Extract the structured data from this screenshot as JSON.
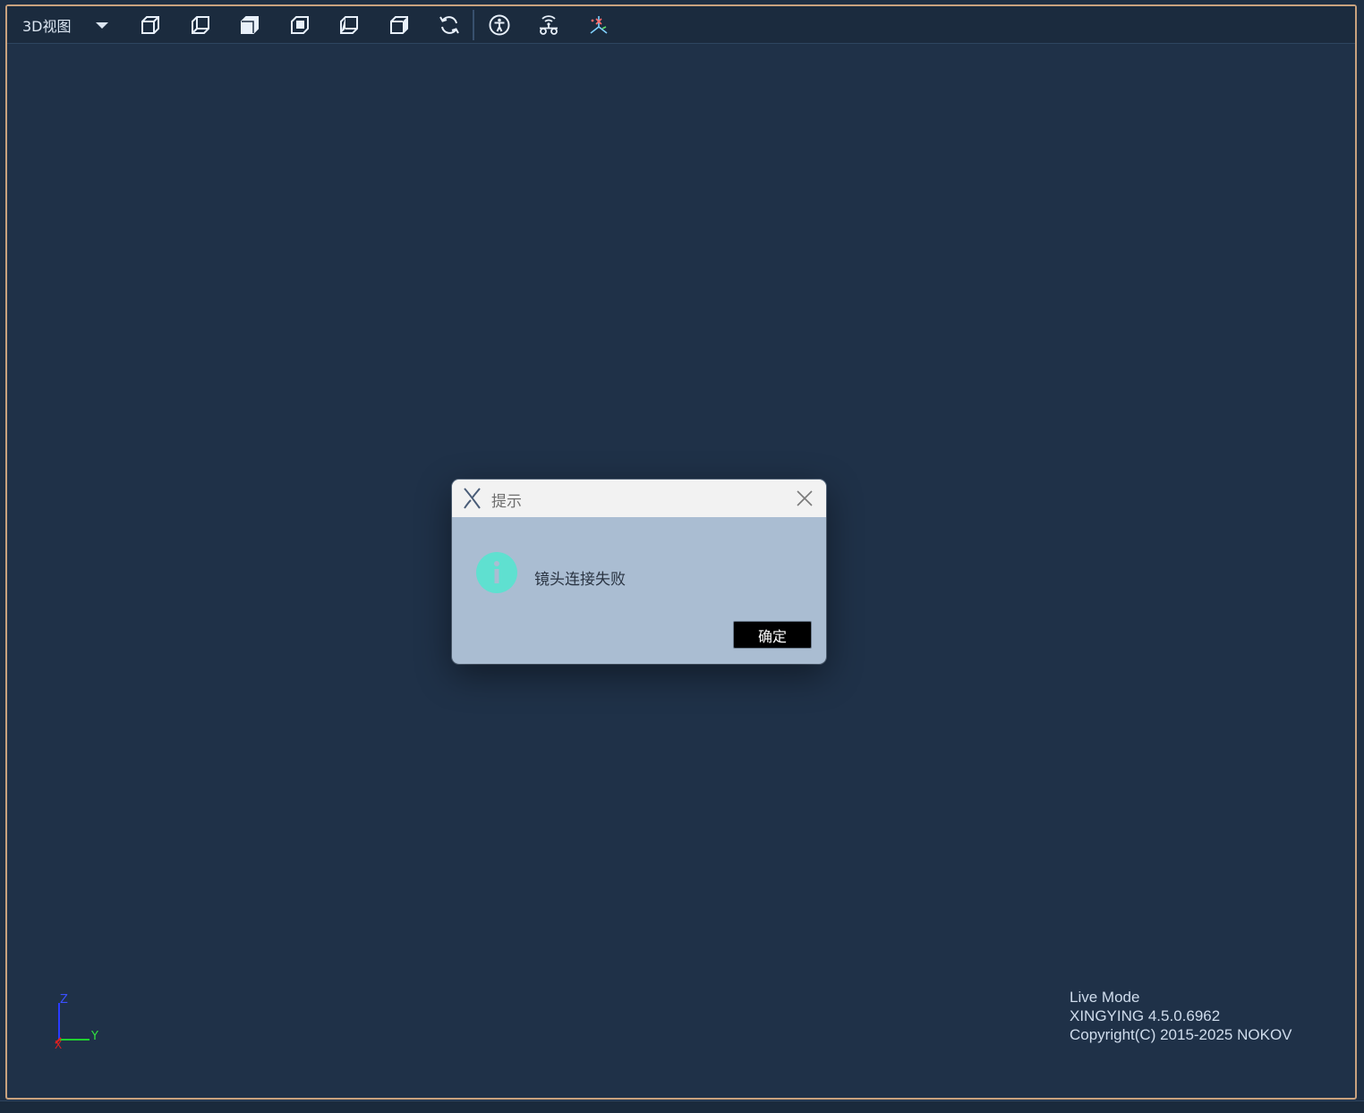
{
  "toolbar": {
    "view_mode": "3D视图",
    "buttons": [
      {
        "icon": "cube-front-icon"
      },
      {
        "icon": "cube-back-icon"
      },
      {
        "icon": "cube-left-icon"
      },
      {
        "icon": "cube-right-icon"
      },
      {
        "icon": "cube-top-icon"
      },
      {
        "icon": "cube-bottom-icon"
      },
      {
        "icon": "refresh-icon"
      },
      {
        "icon": "human-body-icon"
      },
      {
        "icon": "wireless-camera-icon"
      },
      {
        "icon": "axis-calibration-icon"
      }
    ]
  },
  "dialog": {
    "title": "提示",
    "message": "镜头连接失败",
    "ok_label": "确定"
  },
  "axis": {
    "z": "Z",
    "y": "Y",
    "x": "X"
  },
  "status": {
    "mode": "Live Mode",
    "version": "XINGYING 4.5.0.6962",
    "copyright": "Copyright(C) 2015-2025 NOKOV"
  },
  "colors": {
    "background": "#1f3148",
    "frame_border": "#c9a27e",
    "dialog_body": "#aabdd2",
    "info_icon": "#5fe0d0",
    "ok_button": "#000000"
  }
}
